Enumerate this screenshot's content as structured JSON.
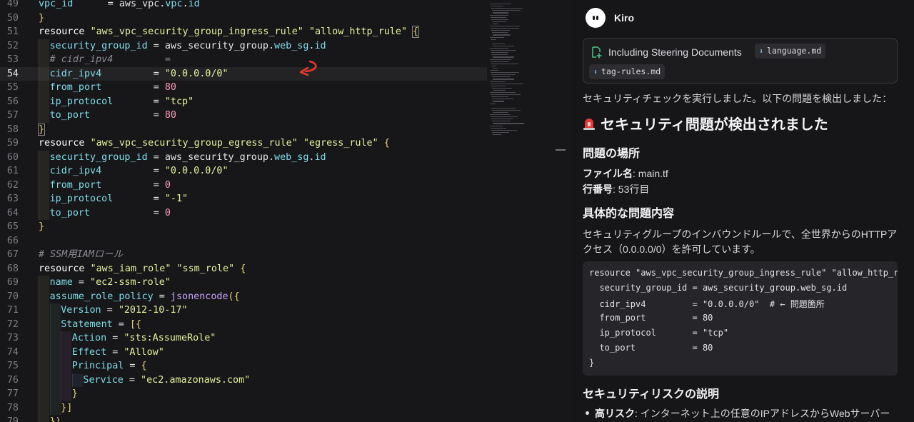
{
  "editor": {
    "lines": [
      {
        "n": "49",
        "segs": [
          [
            "a",
            "vpc_id"
          ],
          [
            "p",
            "      = aws_vpc."
          ],
          [
            "a",
            "vpc"
          ],
          [
            "p",
            "."
          ],
          [
            "a",
            "id"
          ]
        ]
      },
      {
        "n": "50",
        "segs": [
          [
            "y",
            "}"
          ]
        ]
      },
      {
        "n": "51",
        "segs": [
          [
            "k",
            "resource "
          ],
          [
            "s",
            "\"aws_vpc_security_group_ingress_rule\""
          ],
          [
            "p",
            " "
          ],
          [
            "s",
            "\"allow_http_rule\""
          ],
          [
            "p",
            " "
          ],
          [
            "y",
            "{"
          ]
        ]
      },
      {
        "n": "52",
        "segs": [
          [
            "a",
            "security_group_id"
          ],
          [
            "p",
            " = aws_security_group."
          ],
          [
            "a",
            "web_sg"
          ],
          [
            "p",
            "."
          ],
          [
            "a",
            "id"
          ]
        ]
      },
      {
        "n": "53",
        "segs": [
          [
            "c",
            "# cidr_ipv4         ="
          ]
        ]
      },
      {
        "n": "54",
        "segs": [
          [
            "a",
            "cidr_ipv4"
          ],
          [
            "p",
            "         = "
          ],
          [
            "s",
            "\"0.0.0.0/0\""
          ]
        ]
      },
      {
        "n": "55",
        "segs": [
          [
            "a",
            "from_port"
          ],
          [
            "p",
            "         = "
          ],
          [
            "n",
            "80"
          ]
        ]
      },
      {
        "n": "56",
        "segs": [
          [
            "a",
            "ip_protocol"
          ],
          [
            "p",
            "       = "
          ],
          [
            "s",
            "\"tcp\""
          ]
        ]
      },
      {
        "n": "57",
        "segs": [
          [
            "a",
            "to_port"
          ],
          [
            "p",
            "           = "
          ],
          [
            "n",
            "80"
          ]
        ]
      },
      {
        "n": "58",
        "segs": [
          [
            "y",
            "}"
          ]
        ]
      },
      {
        "n": "59",
        "segs": [
          [
            "k",
            "resource "
          ],
          [
            "s",
            "\"aws_vpc_security_group_egress_rule\""
          ],
          [
            "p",
            " "
          ],
          [
            "s",
            "\"egress_rule\""
          ],
          [
            "p",
            " "
          ],
          [
            "y",
            "{"
          ]
        ]
      },
      {
        "n": "60",
        "segs": [
          [
            "a",
            "security_group_id"
          ],
          [
            "p",
            " = aws_security_group."
          ],
          [
            "a",
            "web_sg"
          ],
          [
            "p",
            "."
          ],
          [
            "a",
            "id"
          ]
        ]
      },
      {
        "n": "61",
        "segs": [
          [
            "a",
            "cidr_ipv4"
          ],
          [
            "p",
            "         = "
          ],
          [
            "s",
            "\"0.0.0.0/0\""
          ]
        ]
      },
      {
        "n": "62",
        "segs": [
          [
            "a",
            "from_port"
          ],
          [
            "p",
            "         = "
          ],
          [
            "n",
            "0"
          ]
        ]
      },
      {
        "n": "63",
        "segs": [
          [
            "a",
            "ip_protocol"
          ],
          [
            "p",
            "       = "
          ],
          [
            "s",
            "\"-1\""
          ]
        ]
      },
      {
        "n": "64",
        "segs": [
          [
            "a",
            "to_port"
          ],
          [
            "p",
            "           = "
          ],
          [
            "n",
            "0"
          ]
        ]
      },
      {
        "n": "65",
        "segs": [
          [
            "y",
            "}"
          ]
        ]
      },
      {
        "n": "66",
        "segs": []
      },
      {
        "n": "67",
        "segs": [
          [
            "c",
            "# SSM用IAMロール"
          ]
        ]
      },
      {
        "n": "68",
        "segs": [
          [
            "k",
            "resource "
          ],
          [
            "s",
            "\"aws_iam_role\""
          ],
          [
            "p",
            " "
          ],
          [
            "s",
            "\"ssm_role\""
          ],
          [
            "p",
            " "
          ],
          [
            "y",
            "{"
          ]
        ]
      },
      {
        "n": "69",
        "segs": [
          [
            "a",
            "name"
          ],
          [
            "p",
            " = "
          ],
          [
            "s",
            "\"ec2-ssm-role\""
          ]
        ]
      },
      {
        "n": "70",
        "segs": [
          [
            "a",
            "assume_role_policy"
          ],
          [
            "p",
            " = "
          ],
          [
            "f",
            "jsonencode"
          ],
          [
            "y",
            "({"
          ]
        ]
      },
      {
        "n": "71",
        "segs": [
          [
            "a",
            "Version"
          ],
          [
            "p",
            " = "
          ],
          [
            "s",
            "\"2012-10-17\""
          ]
        ]
      },
      {
        "n": "72",
        "segs": [
          [
            "a",
            "Statement"
          ],
          [
            "p",
            " = "
          ],
          [
            "y",
            "[{"
          ]
        ]
      },
      {
        "n": "73",
        "segs": [
          [
            "a",
            "Action"
          ],
          [
            "p",
            " = "
          ],
          [
            "s",
            "\"sts:AssumeRole\""
          ]
        ]
      },
      {
        "n": "74",
        "segs": [
          [
            "a",
            "Effect"
          ],
          [
            "p",
            " = "
          ],
          [
            "s",
            "\"Allow\""
          ]
        ]
      },
      {
        "n": "75",
        "segs": [
          [
            "a",
            "Principal"
          ],
          [
            "p",
            " = "
          ],
          [
            "y",
            "{"
          ]
        ]
      },
      {
        "n": "76",
        "segs": [
          [
            "a",
            "Service"
          ],
          [
            "p",
            " = "
          ],
          [
            "s",
            "\"ec2.amazonaws.com\""
          ]
        ]
      },
      {
        "n": "77",
        "segs": [
          [
            "y",
            "}"
          ]
        ]
      },
      {
        "n": "78",
        "segs": [
          [
            "y",
            "}]"
          ]
        ]
      },
      {
        "n": "79",
        "segs": [
          [
            "y",
            "})"
          ]
        ]
      }
    ]
  },
  "chat": {
    "title": "Kiro",
    "steering": {
      "label": "Including Steering Documents",
      "files": [
        "language.md",
        "tag-rules.md"
      ]
    },
    "intro": "セキュリティチェックを実行しました。以下の問題を検出しました：",
    "alert_heading": "セキュリティ問題が検出されました",
    "location_heading": "問題の場所",
    "file_key": "ファイル名",
    "file_val": ": main.tf",
    "line_key": "行番号",
    "line_val": ": 53行目",
    "detail_heading": "具体的な問題内容",
    "detail_line1": "セキュリティグループのインバウンドルールで、全世界からのHTTPア",
    "detail_line2": "クセス（0.0.0.0/0）を許可しています。",
    "code_lines": [
      "resource \"aws_vpc_security_group_ingress_rule\" \"allow_http_rule\" {",
      "  security_group_id = aws_security_group.web_sg.id",
      "  cidr_ipv4         = \"0.0.0.0/0\"  # ← 問題箇所",
      "  from_port         = 80",
      "  ip_protocol       = \"tcp\"",
      "  to_port           = 80",
      "}"
    ],
    "risk_heading": "セキュリティリスクの説明",
    "risk_bold": "高リスク",
    "risk_text": ": インターネット上の任意のIPアドレスからWebサーバー"
  }
}
